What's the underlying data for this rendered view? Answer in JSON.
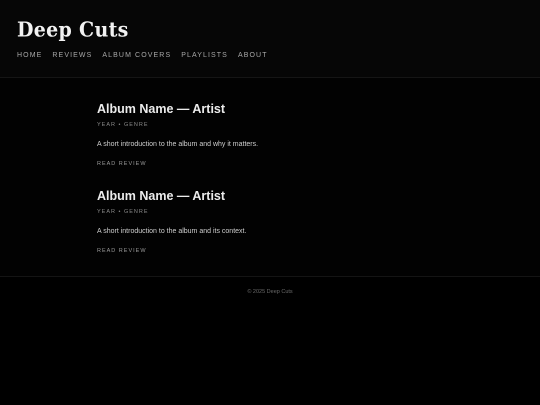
{
  "site": {
    "logo": "Deep Cuts"
  },
  "nav": {
    "items": [
      {
        "label": "HOME"
      },
      {
        "label": "REVIEWS"
      },
      {
        "label": "ALBUM COVERS"
      },
      {
        "label": "PLAYLISTS"
      },
      {
        "label": "ABOUT"
      }
    ]
  },
  "posts": [
    {
      "title": "Album Name — Artist",
      "meta": "YEAR • GENRE",
      "excerpt": "A short introduction to the album and why it matters.",
      "link": "READ REVIEW"
    },
    {
      "title": "Album Name — Artist",
      "meta": "YEAR • GENRE",
      "excerpt": "A short introduction to the album and its context.",
      "link": "READ REVIEW"
    }
  ],
  "footer": {
    "copyright": "© 2025 Deep Cuts"
  },
  "colors": {
    "background": "#000000",
    "header_background": "#060606",
    "text": "#e6e6e6"
  }
}
